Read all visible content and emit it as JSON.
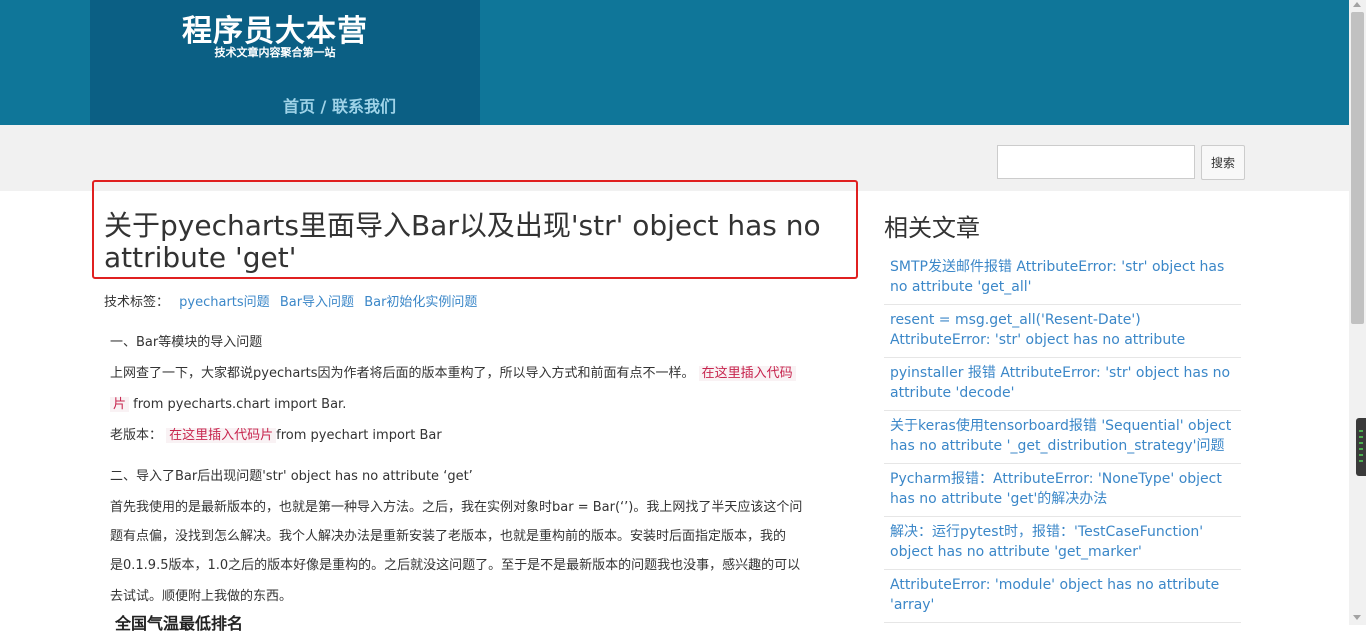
{
  "header": {
    "site_title": "程序员大本营",
    "site_subtitle": "技术文章内容聚合第一站",
    "nav": [
      "首页 /",
      "联系我们"
    ]
  },
  "search": {
    "placeholder": "",
    "value": "",
    "button_label": "搜索"
  },
  "article": {
    "title": "关于pyecharts里面导入Bar以及出现'str' object has no attribute 'get'",
    "tags_label": "技术标签：",
    "tags": [
      "pyecharts问题",
      "Bar导入问题",
      "Bar初始化实例问题"
    ],
    "section1_heading": "一、Bar等模块的导入问题",
    "p1_text": "上网查了一下，大家都说pyecharts因为作者将后面的版本重构了，所以导入方式和前面有点不一样。",
    "p1_code_a": "在这里插入代码",
    "p1_code_b": "片",
    "p1_tail": " from pyecharts.chart import Bar.",
    "p2_prefix": "老版本：",
    "p2_code": "在这里插入代码片",
    "p2_tail": "from pyechart import Bar",
    "section2_heading": "二、导入了Bar后出现问题'str' object has no attribute ‘get’",
    "p3_lines": [
      "首先我使用的是最新版本的，也就是第一种导入方法。之后，我在实例对象时bar = Bar(‘’)。我上网找了半天应该这个问",
      "题有点偏，没找到怎么解决。我个人解决办法是重新安装了老版本，也就是重构前的版本。安装时后面指定版本，我的",
      "是0.1.9.5版本，1.0之后的版本好像是重构的。之后就没这问题了。至于是不是最新版本的问题我也没事，感兴趣的可以",
      "去试试。顺便附上我做的东西。"
    ],
    "figure_title": "全国气温最低排名"
  },
  "related": {
    "heading": "相关文章",
    "items": [
      "SMTP发送邮件报错 AttributeError: 'str' object has no attribute 'get_all'",
      "resent = msg.get_all('Resent-Date') AttributeError: 'str' object has no attribute 'get_all'",
      "pyinstaller 报错 AttributeError: 'str' object has no attribute 'decode'",
      "关于keras使用tensorboard报错 'Sequential' object has no attribute '_get_distribution_strategy'问题解决方案",
      "Pycharm报错：AttributeError: 'NoneType' object has no attribute 'get'的解决办法",
      "解决：运行pytest时，报错：'TestCaseFunction' object has no attribute 'get_marker'",
      "AttributeError: 'module' object has no attribute 'array'"
    ]
  },
  "colors": {
    "header_bg": "#0f7699",
    "brand_bg": "#0b5f84",
    "link": "#3b87c8",
    "highlight_border": "#e02020"
  }
}
